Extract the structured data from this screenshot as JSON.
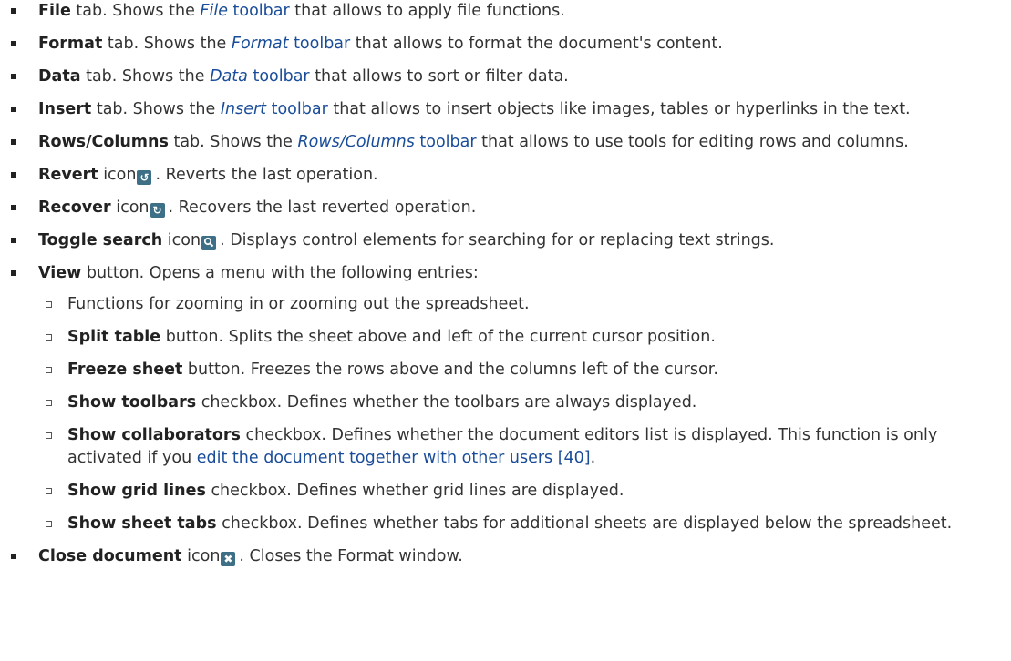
{
  "items": [
    {
      "b": "File",
      "t1": " tab. Shows the ",
      "li": "File",
      "ln": " toolbar",
      "t2": " that allows to apply file functions."
    },
    {
      "b": "Format",
      "t1": " tab. Shows the ",
      "li": "Format",
      "ln": " toolbar",
      "t2": " that allows to format the document's content."
    },
    {
      "b": "Data",
      "t1": " tab. Shows the ",
      "li": "Data",
      "ln": " toolbar",
      "t2": " that allows to sort or filter data."
    },
    {
      "b": "Insert",
      "t1": " tab. Shows the ",
      "li": "Insert",
      "ln": " toolbar",
      "t2": " that allows to insert objects like images, tables or hyperlinks in the text."
    },
    {
      "b": "Rows/Columns",
      "t1": " tab. Shows the ",
      "li": "Rows/Columns",
      "ln": " toolbar",
      "t2": " that allows to use tools for editing rows and columns."
    },
    {
      "b": "Revert",
      "t1": " icon",
      "icon": "revert-icon",
      "t2": ". Reverts the last operation."
    },
    {
      "b": "Recover",
      "t1": " icon",
      "icon": "recover-icon",
      "t2": ". Recovers the last reverted operation."
    },
    {
      "b": "Toggle search",
      "t1": " icon",
      "icon": "search-icon",
      "t2": ". Displays control elements for searching for or replacing text strings."
    },
    {
      "b": "View",
      "t1": " button. Opens a menu with the following entries:"
    },
    {
      "b": "Close document",
      "t1": " icon",
      "icon": "close-icon",
      "t2": ". Closes the Format window."
    }
  ],
  "view_sub": [
    {
      "t": "Functions for zooming in or zooming out the spreadsheet."
    },
    {
      "b": "Split table",
      "t": " button. Splits the sheet above and left of the current cursor position."
    },
    {
      "b": "Freeze sheet",
      "t": " button. Freezes the rows above and the columns left of the cursor."
    },
    {
      "b": "Show toolbars",
      "t": " checkbox. Defines whether the toolbars are always displayed."
    },
    {
      "b": "Show collaborators",
      "t": " checkbox. Defines whether the document editors list is displayed. This function is only activated if you ",
      "link": "edit the document together with other users [40]",
      "t2": "."
    },
    {
      "b": "Show grid lines",
      "t": " checkbox. Defines whether grid lines are displayed."
    },
    {
      "b": "Show sheet tabs",
      "t": " checkbox. Defines whether tabs for additional sheets are displayed below the spreadsheet."
    }
  ],
  "icon_color": "#3d6f86",
  "link_color": "#1a4d99"
}
